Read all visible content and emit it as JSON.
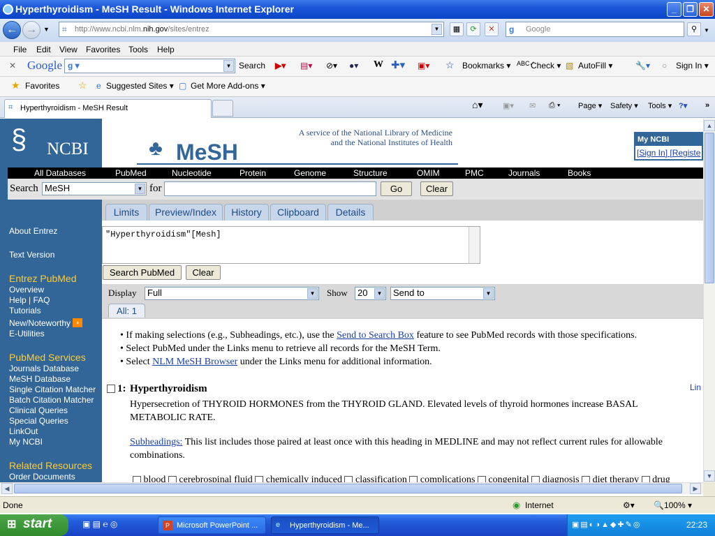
{
  "window": {
    "title": "Hyperthyroidism - MeSH Result - Windows Internet Explorer"
  },
  "nav": {
    "address": "http://www.ncbi.nlm.nih.gov/sites/entrez",
    "address_host_prefix": "http://www.ncbi.nlm.",
    "address_host_bold": "nih.gov",
    "address_path": "/sites/entrez",
    "search_placeholder": "Google"
  },
  "menubar": [
    "File",
    "Edit",
    "View",
    "Favorites",
    "Tools",
    "Help"
  ],
  "googlebar": {
    "logo": "Google",
    "search_label": "Search",
    "bookmarks": "Bookmarks",
    "check": "Check",
    "autofill": "AutoFill",
    "signin": "Sign In"
  },
  "favbar": {
    "favorites": "Favorites",
    "suggested": "Suggested Sites",
    "addons": "Get More Add-ons"
  },
  "tabs": {
    "active": "Hyperthyroidism - MeSH Result",
    "page": "Page",
    "safety": "Safety",
    "tools": "Tools"
  },
  "page": {
    "ncbi_logo": "NCBI",
    "service_line1": "A service of the National Library of Medicine",
    "service_line2": "and the National Institutes of Health",
    "mesh_logo": "MeSH",
    "my_ncbi": "My NCBI",
    "sign_in": "[Sign In]",
    "register": "[Registe",
    "databases": [
      "All Databases",
      "PubMed",
      "Nucleotide",
      "Protein",
      "Genome",
      "Structure",
      "OMIM",
      "PMC",
      "Journals",
      "Books"
    ],
    "search_label": "Search",
    "search_db": "MeSH",
    "for_label": "for",
    "search_value": "",
    "go": "Go",
    "clear": "Clear",
    "page_tabs": [
      "Limits",
      "Preview/Index",
      "History",
      "Clipboard",
      "Details"
    ],
    "query": "\"Hyperthyroidism\"[Mesh]",
    "search_pubmed": "Search PubMed",
    "clear2": "Clear",
    "display_label": "Display",
    "display_value": "Full",
    "show_label": "Show",
    "show_value": "20",
    "send_to": "Send to",
    "all_tab": "All: 1",
    "bullets": [
      {
        "pre": "If making selections (e.g., Subheadings, etc.), use the ",
        "link": "Send to Search Box",
        "post": " feature to see PubMed records with those specifications."
      },
      {
        "pre": "Select PubMed under the Links menu to retrieve all records for the MeSH Term.",
        "link": "",
        "post": ""
      },
      {
        "pre": "Select ",
        "link": "NLM MeSH Browser",
        "post": " under the Links menu for additional information."
      }
    ],
    "result_number": "1:",
    "result_title": "Hyperthyroidism",
    "links_label": "Lin",
    "result_desc1": "Hypersecretion of THYROID HORMONES from the THYROID GLAND. Elevated levels of thyroid hormones increase BASAL",
    "result_desc2": "METABOLIC RATE.",
    "subheadings_link": "Subheadings:",
    "subheadings_text1": " This list includes those paired at least once with this heading in MEDLINE and may not reflect current rules for allowable",
    "subheadings_text2": "combinations.",
    "subheadings": [
      "blood",
      "cerebrospinal fluid",
      "chemically induced",
      "classification",
      "complications",
      "congenital",
      "diagnosis",
      "diet therapy",
      "drug"
    ]
  },
  "sidebar": {
    "links_top": [
      "About Entrez",
      "Text Version"
    ],
    "entrez_head": "Entrez PubMed",
    "entrez_links": [
      "Overview",
      "Help | FAQ",
      "Tutorials",
      "New/Noteworthy",
      "E-Utilities"
    ],
    "services_head": "PubMed Services",
    "services_links": [
      "Journals Database",
      "MeSH Database",
      "Single Citation Matcher",
      "Batch Citation Matcher",
      "Clinical Queries",
      "Special Queries",
      "LinkOut",
      "My NCBI"
    ],
    "related_head": "Related Resources",
    "related_links": [
      "Order Documents"
    ]
  },
  "status": {
    "text": "Done",
    "zone": "Internet",
    "zoom": "100%"
  },
  "taskbar": {
    "start": "start",
    "task1": "Microsoft PowerPoint ...",
    "task2": "Hyperthyroidism - Me...",
    "clock": "22:23"
  },
  "colors": {
    "ncbi_blue": "#326698",
    "side_heading": "#ffcc33",
    "link": "#1a3ea8",
    "xp_blue": "#245edb"
  }
}
